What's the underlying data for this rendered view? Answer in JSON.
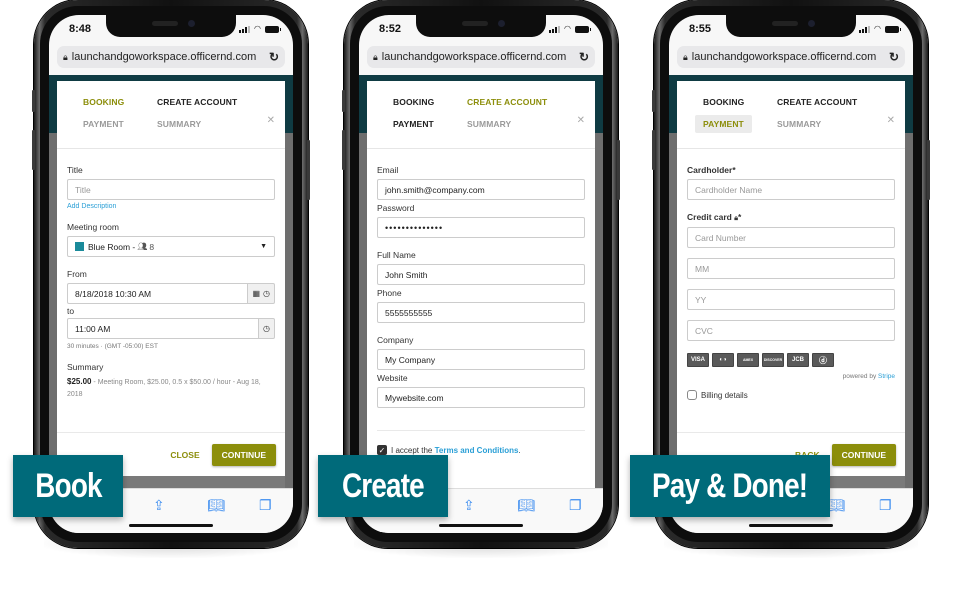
{
  "browser": {
    "url": "launchandgoworkspace.officernd.com"
  },
  "steps": {
    "booking": "BOOKING",
    "create_account": "CREATE ACCOUNT",
    "payment": "PAYMENT",
    "summary": "SUMMARY"
  },
  "labels_overlay": [
    "Book",
    "Create",
    "Pay & Done!"
  ],
  "phones": [
    {
      "time": "8:48",
      "active_step": "booking",
      "form": {
        "title_label": "Title",
        "title_placeholder": "Title",
        "add_description": "Add Description",
        "meeting_room_label": "Meeting room",
        "meeting_room_value": "Blue Room - ",
        "meeting_room_capacity": "8",
        "meeting_room_color": "#1a8a9a",
        "from_label": "From",
        "from_value": "8/18/2018 10:30 AM",
        "to_label": "to",
        "to_value": "11:00 AM",
        "duration_note": "30 minutes  ·  (GMT -05:00) EST",
        "summary_label": "Summary",
        "summary_price": "$25.00",
        "summary_detail": " - Meeting Room, $25.00, 0.5 x $50.00 / hour - Aug 18, 2018"
      },
      "footer": {
        "secondary": "CLOSE",
        "primary": "CONTINUE"
      }
    },
    {
      "time": "8:52",
      "active_step": "create_account",
      "form": {
        "email_label": "Email",
        "email_value": "john.smith@company.com",
        "password_label": "Password",
        "password_value": "••••••••••••••",
        "fullname_label": "Full Name",
        "fullname_value": "John Smith",
        "phone_label": "Phone",
        "phone_value": "5555555555",
        "company_label": "Company",
        "company_value": "My Company",
        "website_label": "Website",
        "website_value": "Mywebsite.com",
        "accept_prefix": "I accept the ",
        "accept_link": "Terms and Conditions",
        "accept_suffix": ".",
        "accept_checked": true
      }
    },
    {
      "time": "8:55",
      "active_step": "payment",
      "form": {
        "cardholder_label": "Cardholder*",
        "cardholder_placeholder": "Cardholder Name",
        "credit_card_label": "Credit card",
        "credit_card_required": "*",
        "card_number_placeholder": "Card Number",
        "mm_placeholder": "MM",
        "yy_placeholder": "YY",
        "cvc_placeholder": "CVC",
        "card_brands": [
          "VISA",
          "MC",
          "AMEX",
          "DISCOVER",
          "JCB",
          "DINERS"
        ],
        "powered_by": "powered by ",
        "powered_brand": "Stripe",
        "billing_details": "Billing details",
        "billing_checked": false
      },
      "footer": {
        "secondary": "BACK",
        "primary": "CONTINUE"
      }
    }
  ],
  "colors": {
    "accent_olive": "#8c8e0b",
    "label_teal": "#006a7a",
    "header_dark_teal": "#0f3b43",
    "link_blue": "#2a9fd6",
    "ios_blue": "#3b8cf0"
  }
}
